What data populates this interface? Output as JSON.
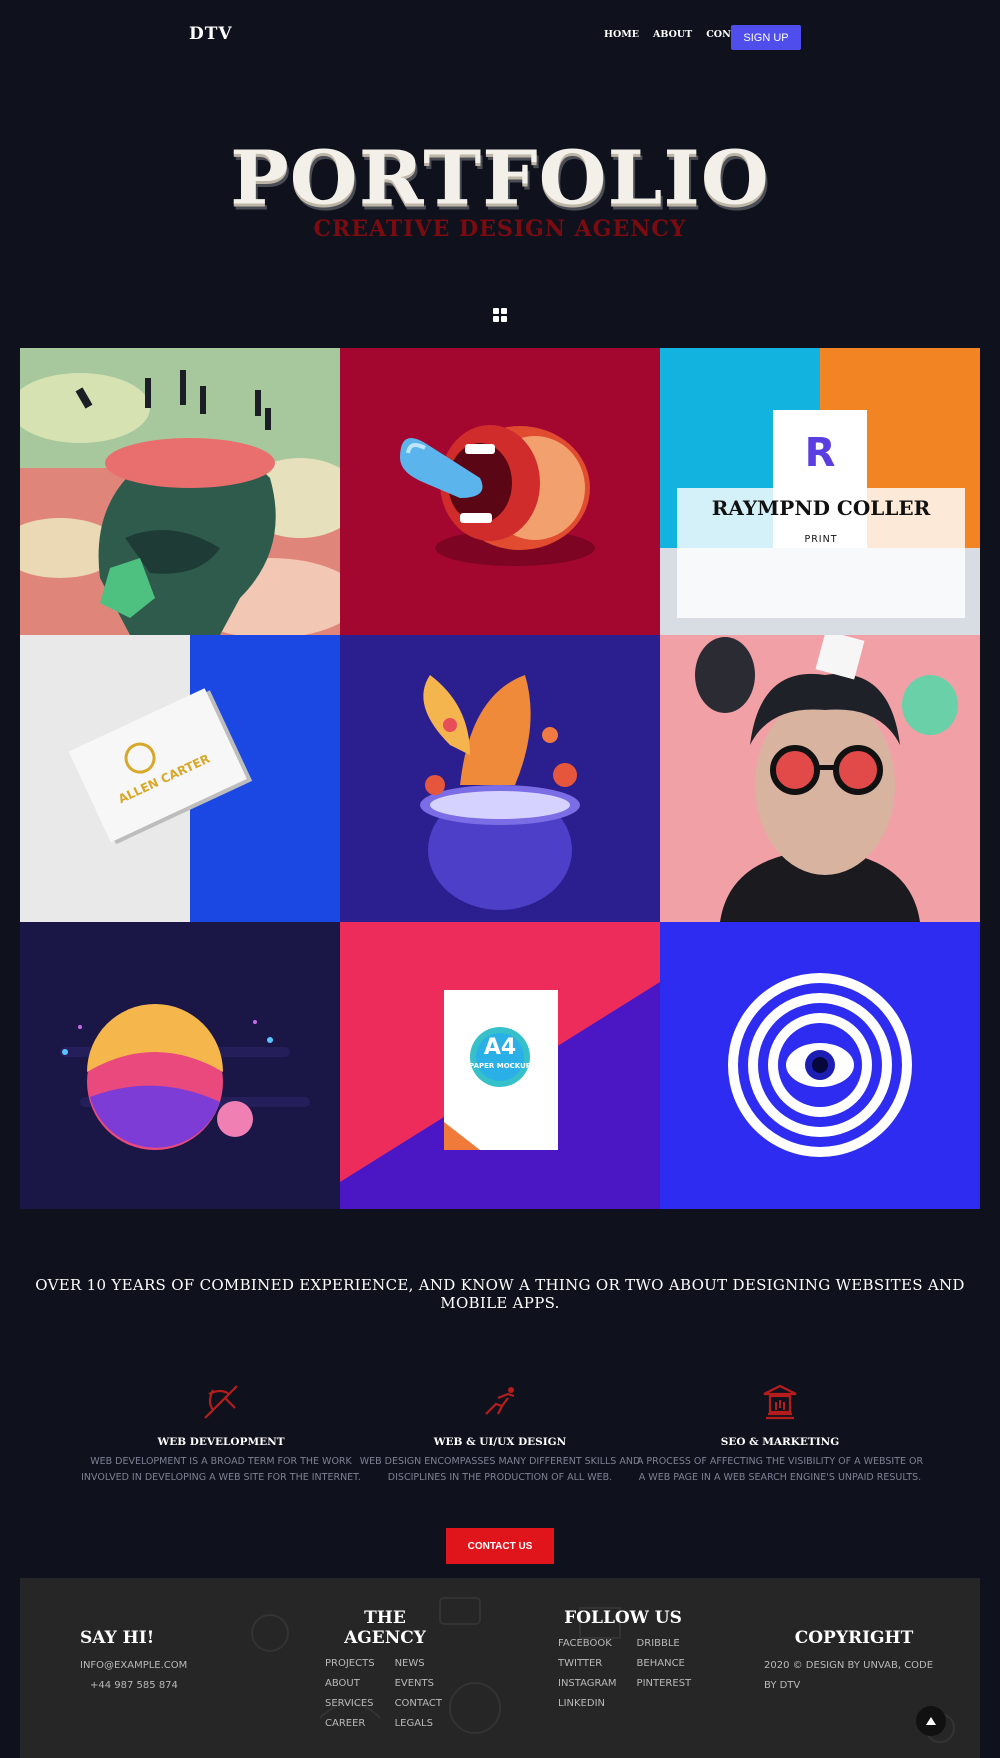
{
  "nav": {
    "logo": "DTV",
    "links": [
      "HOME",
      "ABOUT",
      "CONTACT"
    ],
    "signup_label": "SIGN UP",
    "signup_color": "#4f4dec"
  },
  "hero": {
    "title": "PORTFOLIO",
    "subtitle": "CREATIVE DESIGN AGENCY"
  },
  "gallery": {
    "overlay": {
      "title": "RAYMPND COLLER",
      "subtitle": "PRINT"
    },
    "business_card_name": "ALLEN CARTER",
    "a4_mockup_label": "A4",
    "a4_mockup_sub": "PAPER MOCKUP",
    "letter_logo": "R"
  },
  "tagline": "OVER 10 YEARS OF COMBINED EXPERIENCE, AND KNOW A THING OR TWO ABOUT DESIGNING WEBSITES AND MOBILE APPS.",
  "services": [
    {
      "icon": "crossbow-icon",
      "title": "WEB DEVELOPMENT",
      "desc": "Web development is a broad term for the work involved in developing a web site for the Internet."
    },
    {
      "icon": "runner-icon",
      "title": "WEB & UI/UX DESIGN",
      "desc": "Web design encompasses many different skills and disciplines in the production of all web."
    },
    {
      "icon": "temple-icon",
      "title": "SEO & MARKETING",
      "desc": "A process of affecting the visibility of a website or a web page in a web search engine's unpaid results."
    }
  ],
  "contact_button": "CONTACT US",
  "footer": {
    "say_hi": {
      "heading": "SAY HI!",
      "email": "INFO@EXAMPLE.COM",
      "phone": "+44 987 585 874"
    },
    "agency": {
      "heading": "THE AGENCY",
      "col1": [
        "PROJECTS",
        "ABOUT",
        "SERVICES",
        "CAREER"
      ],
      "col2": [
        "NEWS",
        "EVENTS",
        "CONTACT",
        "LEGALS"
      ]
    },
    "follow": {
      "heading": "FOLLOW US",
      "col1": [
        "FACEBOOK",
        "TWITTER",
        "INSTAGRAM",
        "LINKEDIN"
      ],
      "col2": [
        "DRIBBLE",
        "BEHANCE",
        "PINTEREST"
      ]
    },
    "copyright": {
      "heading": "COPYRIGHT",
      "text": "2020 © DESIGN BY UNVAB, CODE BY DTV"
    }
  },
  "colors": {
    "background": "#0f121d",
    "accent_red": "#e0141b",
    "footer_bg": "#262626"
  }
}
